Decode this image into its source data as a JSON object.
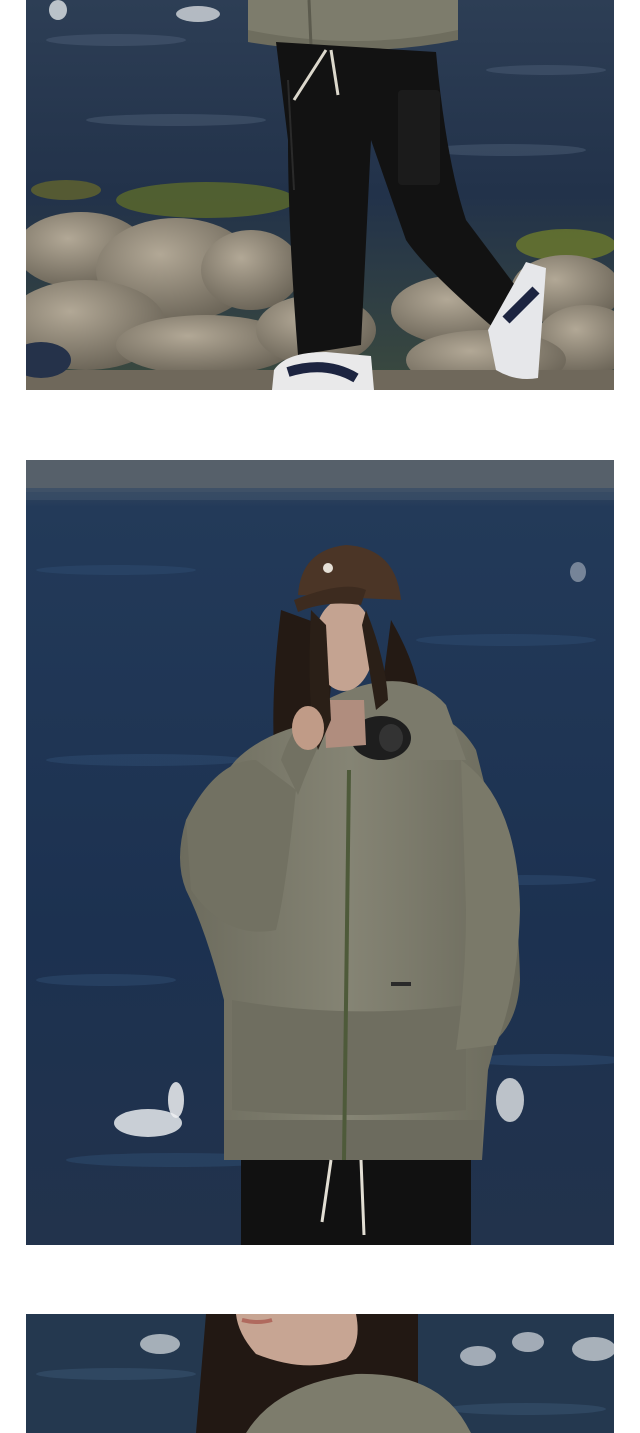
{
  "page": {
    "background": "#ffffff"
  },
  "photos": [
    {
      "subject": "legs-on-rocks",
      "palette": {
        "water": "#2a3a4f",
        "rock": "#8a8274",
        "pants": "#121212",
        "hoodie": "#7d7c6c"
      }
    },
    {
      "subject": "portrait-hoodie",
      "palette": {
        "water": "#1f3553",
        "hoodie": "#7b7a6b",
        "cap": "#4b3526",
        "hair": "#241a14",
        "pants": "#111111"
      }
    },
    {
      "subject": "portrait-crop",
      "palette": {
        "water": "#24384f",
        "hoodie": "#7d7c6c",
        "hair": "#221813"
      }
    }
  ]
}
